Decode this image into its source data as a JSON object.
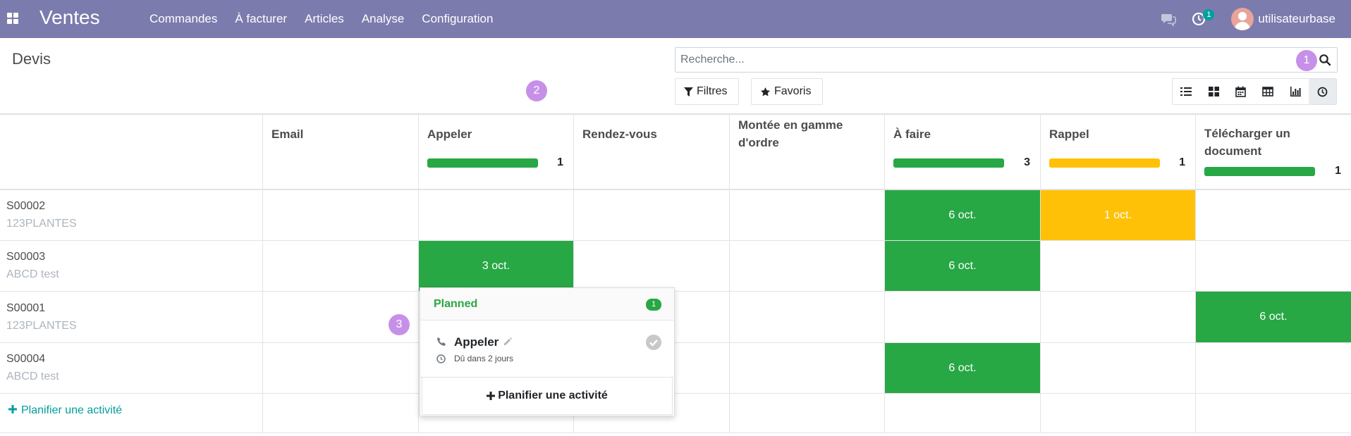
{
  "navbar": {
    "brand": "Ventes",
    "menu": [
      "Commandes",
      "À facturer",
      "Articles",
      "Analyse",
      "Configuration"
    ],
    "activity_count": "1",
    "user_name": "utilisateurbase",
    "bar_color": "#7c7bad"
  },
  "control_panel": {
    "title": "Devis",
    "search_placeholder": "Recherche...",
    "filters_label": "Filtres",
    "favorites_label": "Favoris",
    "views": [
      "list-icon",
      "kanban-icon",
      "calendar-icon",
      "pivot-icon",
      "graph-icon",
      "activity-icon"
    ],
    "active_view": "activity-icon"
  },
  "help_markers": [
    "1",
    "2",
    "3"
  ],
  "columns": [
    {
      "title": "Email",
      "progress_color": null,
      "count": null
    },
    {
      "title": "Appeler",
      "progress_color": "#28a745",
      "count": "1"
    },
    {
      "title": "Rendez-vous",
      "progress_color": null,
      "count": null
    },
    {
      "title": "Montée en gamme d'ordre",
      "progress_color": null,
      "count": null
    },
    {
      "title": "À faire",
      "progress_color": "#28a745",
      "count": "3"
    },
    {
      "title": "Rappel",
      "progress_color": "#ffc107",
      "count": "1"
    },
    {
      "title": "Télécharger un document",
      "progress_color": "#28a745",
      "count": "1"
    }
  ],
  "records": [
    {
      "id": "S00002",
      "partner": "123PLANTES",
      "cells": {
        "4": {
          "label": "6 oct.",
          "color": "green"
        },
        "5": {
          "label": "1 oct.",
          "color": "yellow"
        }
      }
    },
    {
      "id": "S00003",
      "partner": "ABCD test",
      "cells": {
        "1": {
          "label": "3 oct.",
          "color": "green"
        },
        "4": {
          "label": "6 oct.",
          "color": "green"
        }
      }
    },
    {
      "id": "S00001",
      "partner": "123PLANTES",
      "cells": {
        "6": {
          "label": "6 oct.",
          "color": "green"
        }
      }
    },
    {
      "id": "S00004",
      "partner": "ABCD test",
      "cells": {
        "4": {
          "label": "6 oct.",
          "color": "green"
        }
      }
    }
  ],
  "plan_activity_label": "Planifier une activité",
  "popover": {
    "title": "Planned",
    "count": "1",
    "activity_name": "Appeler",
    "due_text": "Dû dans 2 jours",
    "button_label": "Planifier une activité"
  }
}
